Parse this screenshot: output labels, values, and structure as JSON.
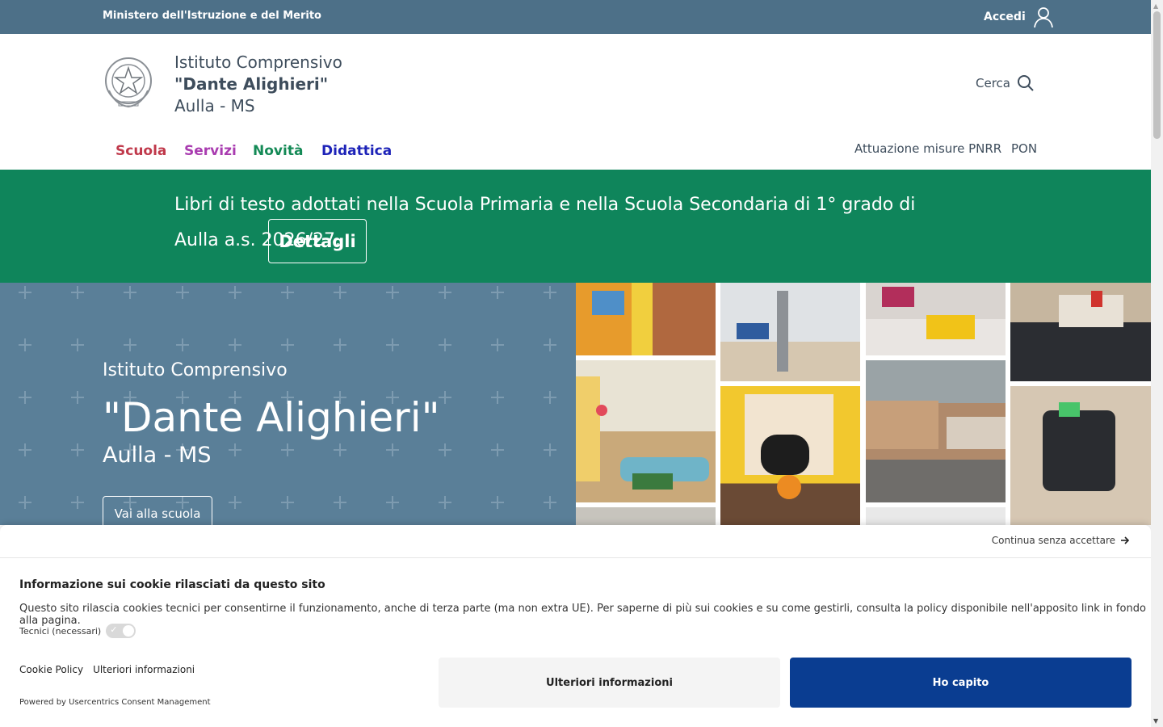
{
  "topbar": {
    "ministry": "Ministero dell'Istruzione e del Merito",
    "login_label": "Accedi"
  },
  "header": {
    "line1": "Istituto Comprensivo",
    "line2": "\"Dante Alighieri\"",
    "line3": "Aulla - MS",
    "search_label": "Cerca"
  },
  "nav": {
    "items": [
      {
        "label": "Scuola",
        "color": "#c0394b"
      },
      {
        "label": "Servizi",
        "color": "#a93cb0"
      },
      {
        "label": "Novità",
        "color": "#148a56"
      },
      {
        "label": "Didattica",
        "color": "#1d23b8"
      }
    ],
    "secondary": [
      "Attuazione misure PNRR",
      "PON"
    ]
  },
  "banner": {
    "text": "Libri di testo adottati nella Scuola Primaria e nella Scuola Secondaria di 1° grado di Aulla a.s. 2026/27.",
    "button": "Dettagli",
    "color": "#0f855b"
  },
  "hero": {
    "line1": "Istituto Comprensivo",
    "line2": "\"Dante Alighieri\"",
    "line3": "Aulla - MS",
    "button": "Vai alla scuola",
    "color": "#5a7f98"
  },
  "cookie": {
    "continue_label": "Continua senza accettare",
    "title": "Informazione sui cookie rilasciati da questo sito",
    "description": "Questo sito rilascia cookies tecnici per consentirne il funzionamento, anche di terza parte (ma non extra UE). Per saperne di più sui cookies e su come gestirli, consulta la policy disponibile nell'apposito link in fondo alla pagina.",
    "toggle_label": "Tecnici (necessari)",
    "links": [
      "Cookie Policy",
      "Ulteriori informazioni"
    ],
    "powered_by": "Powered by Usercentrics Consent Management",
    "more_button": "Ulteriori informazioni",
    "accept_button": "Ho capito",
    "accept_color": "#0a3d91"
  }
}
